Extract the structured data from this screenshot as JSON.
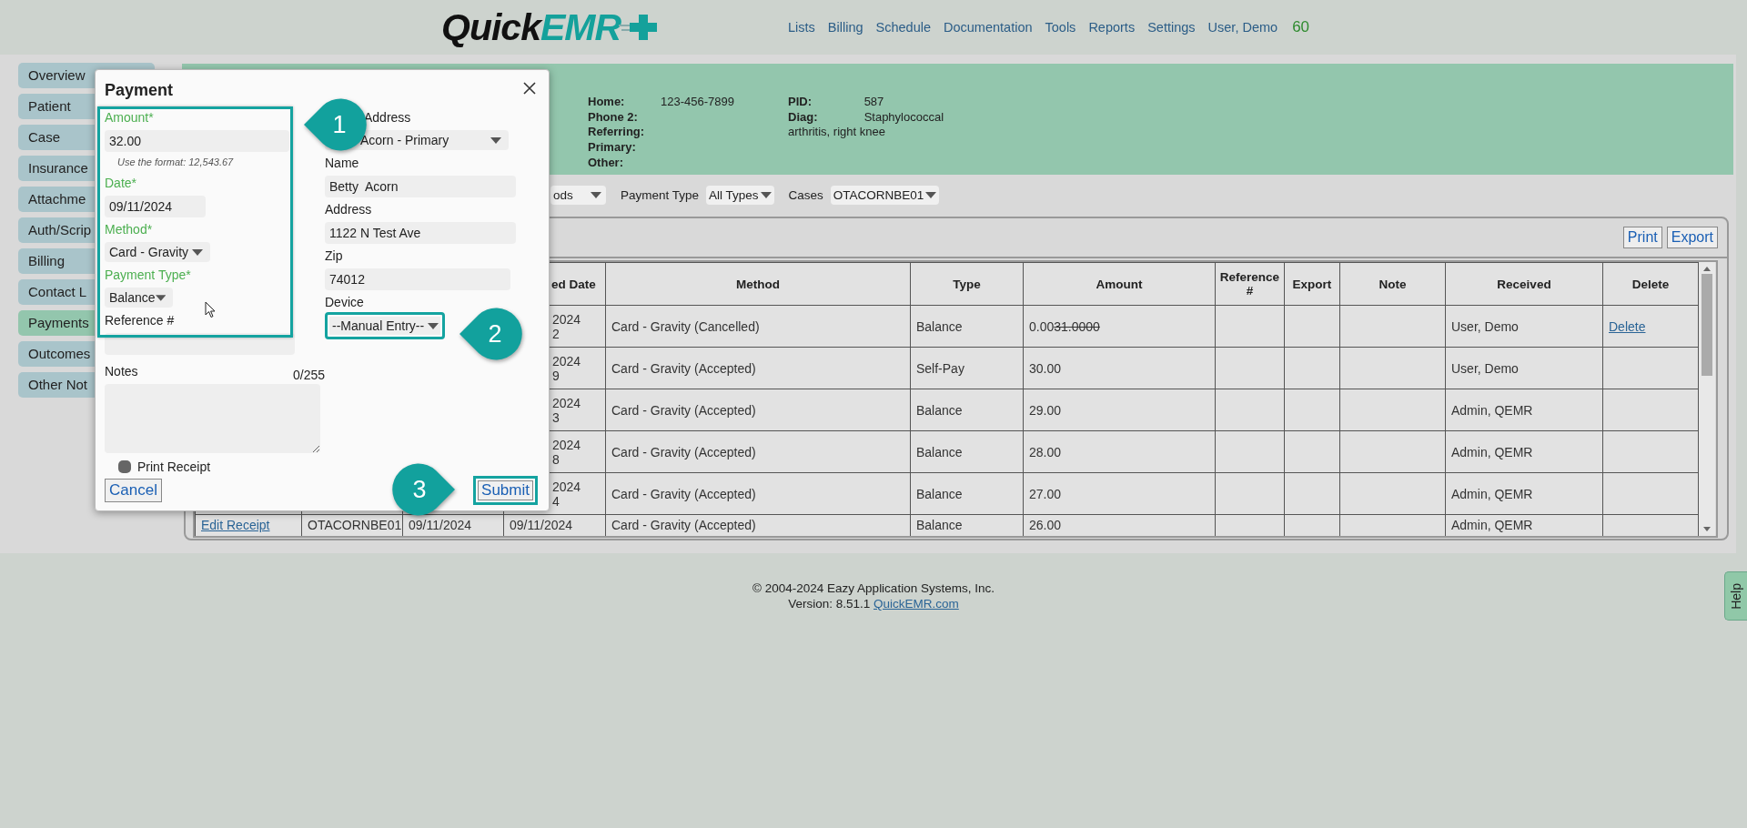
{
  "header": {
    "logo": {
      "part_1": "Quick",
      "part_2": "EMR"
    },
    "nav": [
      "Lists",
      "Billing",
      "Schedule",
      "Documentation",
      "Tools",
      "Reports",
      "Settings",
      "User, Demo"
    ],
    "counter": "60"
  },
  "sidebar": {
    "items": [
      {
        "label": "Overview",
        "selected": false
      },
      {
        "label": "Patient",
        "selected": false
      },
      {
        "label": "Case",
        "selected": false
      },
      {
        "label": "Insurance",
        "selected": false
      },
      {
        "label": "Attachme",
        "selected": false
      },
      {
        "label": "Auth/Scrip",
        "selected": false
      },
      {
        "label": "Billing",
        "selected": false
      },
      {
        "label": "Contact L",
        "selected": false
      },
      {
        "label": "Payments",
        "selected": true
      },
      {
        "label": "Outcomes",
        "selected": false
      },
      {
        "label": "Other Not",
        "selected": false
      }
    ]
  },
  "patient_info": {
    "contact": [
      {
        "label": "Home:",
        "value": "123-456-7899"
      },
      {
        "label": "Phone 2:"
      },
      {
        "label": "Referring:"
      },
      {
        "label": "Primary:"
      },
      {
        "label": "Other:"
      }
    ],
    "ids": [
      {
        "label": "PID:",
        "value": "587"
      },
      {
        "label": "Diag:",
        "value": "Staphylococcal",
        "value_continued": "arthritis, right knee"
      }
    ]
  },
  "filters": {
    "select_fragment": "ods",
    "items": [
      {
        "label": "Payment Type",
        "value": "All Types"
      },
      {
        "label": "Cases",
        "value": "OTACORNBE01"
      }
    ]
  },
  "table": {
    "actions": [
      "Print",
      "Export"
    ],
    "columns": [
      "ed Date",
      "Method",
      "Type",
      "Amount",
      "Reference #",
      "Export",
      "Note",
      "Received",
      "Delete"
    ],
    "rows": [
      {
        "column_4_fragment": [
          "2024",
          "2"
        ],
        "method": "Card - Gravity (Cancelled)",
        "type": "Balance",
        "amount": "0.00",
        "amount_struck": "31.0000",
        "received": "User, Demo",
        "delete": "Delete"
      },
      {
        "column_4_fragment": [
          "2024",
          "9"
        ],
        "method": "Card - Gravity (Accepted)",
        "type": "Self-Pay",
        "amount": "30.00",
        "received": "User, Demo"
      },
      {
        "column_4_fragment": [
          "2024",
          "3"
        ],
        "method": "Card - Gravity (Accepted)",
        "type": "Balance",
        "amount": "29.00",
        "received": "Admin, QEMR"
      },
      {
        "column_4_fragment": [
          "2024",
          "8"
        ],
        "method": "Card - Gravity (Accepted)",
        "type": "Balance",
        "amount": "28.00",
        "received": "Admin, QEMR"
      },
      {
        "column_4_fragment": [
          "2024",
          "4"
        ],
        "method": "Card - Gravity (Accepted)",
        "type": "Balance",
        "amount": "27.00",
        "received": "Admin, QEMR"
      },
      {
        "column_1": "Edit Receipt",
        "column_2": "OTACORNBE01",
        "column_3": "09/11/2024",
        "column_4": [
          "09/11/2024"
        ],
        "method": "Card - Gravity (Accepted)",
        "type": "Balance",
        "amount": "26.00",
        "received": "Admin, QEMR"
      }
    ]
  },
  "payment_dialog": {
    "title": "Payment",
    "left_fields_highlighted": true,
    "left_fields": [
      {
        "kind": "input",
        "label": "Amount*",
        "required": true,
        "value": "32.00",
        "hint": "Use the format: 12,543.67"
      },
      {
        "kind": "input",
        "label": "Date*",
        "required": true,
        "value": "09/11/2024"
      },
      {
        "kind": "select",
        "label": "Method*",
        "required": true,
        "value": "Card - Gravity"
      },
      {
        "kind": "select",
        "label": "Payment Type*",
        "required": true,
        "value": "Balance"
      },
      {
        "kind": "input",
        "label": "Reference #",
        "required": false
      }
    ],
    "right_fields": [
      {
        "kind": "select",
        "label": "Address",
        "value": "Acorn - Primary",
        "highlighted": false
      },
      {
        "kind": "input",
        "label": "Name",
        "value": "Betty  Acorn",
        "highlighted": false
      },
      {
        "kind": "input",
        "label": "Address",
        "value": "1122 N Test Ave",
        "highlighted": false
      },
      {
        "kind": "input",
        "label": "Zip",
        "value": "74012",
        "highlighted": false
      },
      {
        "kind": "select",
        "label": "Device",
        "value": "--Manual Entry--",
        "highlighted": true
      }
    ],
    "notes": {
      "label": "Notes",
      "counter": "0/255"
    },
    "print_receipt": {
      "label": "Print Receipt",
      "checked": false
    },
    "buttons": {
      "cancel": "Cancel",
      "submit": "Submit",
      "submit_highlighted": true
    }
  },
  "annotations": [
    {
      "number": "1",
      "points_right": false
    },
    {
      "number": "2",
      "points_right": false
    },
    {
      "number": "3",
      "points_right": true
    }
  ],
  "footer": {
    "copyright": "© 2004-2024 Eazy Application Systems, Inc.",
    "version": "Version: 8.51.1",
    "link": "QuickEMR.com"
  },
  "help_tab": "Help"
}
